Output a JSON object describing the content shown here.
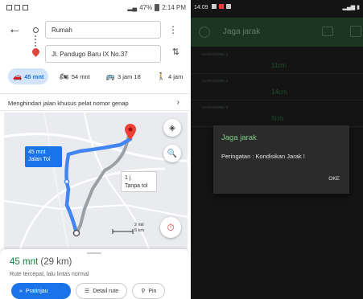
{
  "left_phone": {
    "status_bar": {
      "battery": "47%",
      "time": "2:14 PM"
    },
    "origin": "Rumah",
    "destination": "Jl. Pandugo Baru IX No.37",
    "modes": [
      {
        "icon": "car-icon",
        "label": "45 mnt",
        "active": true
      },
      {
        "icon": "motorcycle-icon",
        "label": "54 mnt",
        "active": false
      },
      {
        "icon": "transit-icon",
        "label": "3 jam 18",
        "active": false
      },
      {
        "icon": "walk-icon",
        "label": "4 jam",
        "active": false
      }
    ],
    "restriction_notice": "Menghindari jalan khusus pelat nomor genap",
    "map": {
      "route_main_label_1": "45 mnt",
      "route_main_label_2": "Jalan Tol",
      "route_alt_label_1": "1 j",
      "route_alt_label_2": "Tanpa tol",
      "scale_1": "2 mil",
      "scale_2": "5 km"
    },
    "sheet": {
      "duration": "45 mnt",
      "distance": "(29 km)",
      "description": "Rute tercepat, lalu lintas normal",
      "preview_btn": "Pratinjau",
      "detail_btn": "Detail rute",
      "pin_btn": "Pin"
    },
    "colors": {
      "accent": "#1a73e8",
      "duration_green": "#188038",
      "pin_red": "#e0453a"
    }
  },
  "right_phone": {
    "status_bar": {
      "time": "14:09"
    },
    "app_title": "Jaga jarak",
    "list": [
      {
        "label": "ULTRASONIK 1",
        "value": "11cm"
      },
      {
        "label": "ULTRASONIK 2",
        "value": "14cm"
      },
      {
        "label": "ULTRASONIK 3",
        "value": "8cm"
      }
    ],
    "dialog": {
      "title": "Jaga jarak",
      "message": "Peringatan : Kondisikan Jarak !",
      "ok_label": "OKE"
    },
    "colors": {
      "background": "#141414",
      "title_bar": "#1c3522",
      "dialog_title": "#7fd28a"
    }
  }
}
